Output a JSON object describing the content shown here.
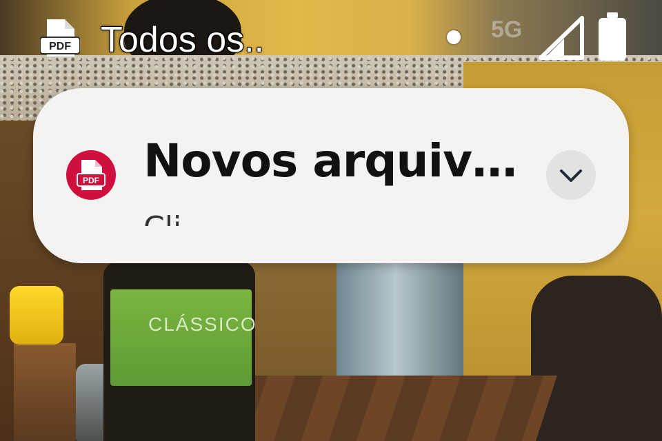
{
  "status_bar": {
    "app_icon": "pdf-file-icon",
    "app_icon_label": "PDF",
    "title": "Todos os..",
    "network": "5G",
    "icons": [
      "notification-dot-icon",
      "signal-icon",
      "battery-icon"
    ]
  },
  "notification": {
    "icon": "pdf-app-icon",
    "icon_label": "PDF",
    "title": "Novos arquiv…",
    "subtitle": "Cli",
    "expand_icon": "chevron-down-icon",
    "accent_color": "#cf0f3d"
  },
  "background": {
    "label_text": "CLÁSSICO"
  }
}
